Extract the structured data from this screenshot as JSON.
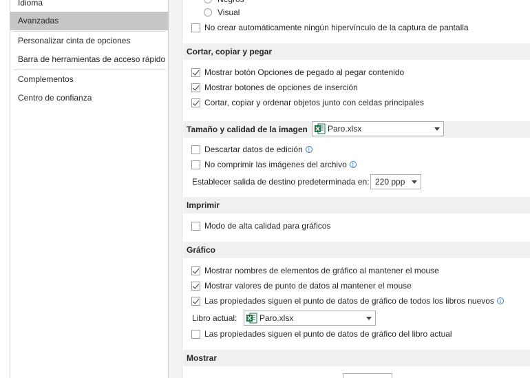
{
  "sidebar": {
    "items": [
      {
        "label": "Idioma"
      },
      {
        "label": "Avanzadas"
      },
      {
        "label": "Personalizar cinta de opciones"
      },
      {
        "label": "Barra de herramientas de acceso rápido"
      },
      {
        "label": "Complementos"
      },
      {
        "label": "Centro de confianza"
      }
    ]
  },
  "top": {
    "radio_partial_label": "Negros",
    "radio_visual_label": "Visual",
    "no_hyperlink_label": "No crear automáticamente ningún hipervínculo de la captura de pantalla"
  },
  "cut_copy_paste": {
    "header": "Cortar, copiar y pegar",
    "show_paste_options": "Mostrar botón Opciones de pegado al pegar contenido",
    "show_insert_options": "Mostrar botones de opciones de inserción",
    "cut_copy_sort": "Cortar, copiar y ordenar objetos junto con celdas principales"
  },
  "image_size": {
    "header": "Tamaño y calidad de la imagen",
    "file_dropdown": "Paro.xlsx",
    "discard_edit_data": "Descartar datos de edición",
    "no_compress": "No comprimir las imágenes del archivo",
    "default_output_label": "Establecer salida de destino predeterminada en:",
    "ppi_value": "220 ppp"
  },
  "print": {
    "header": "Imprimir",
    "high_quality": "Modo de alta calidad para gráficos"
  },
  "chart": {
    "header": "Gráfico",
    "show_element_names": "Mostrar nombres de elementos de gráfico al mantener el mouse",
    "show_data_values": "Mostrar valores de punto de datos al mantener el mouse",
    "props_all_workbooks": "Las propiedades siguen el punto de datos de gráfico de todos los libros nuevos",
    "current_book_label": "Libro actual:",
    "current_book_value": "Paro.xlsx",
    "props_current_workbook": "Las propiedades siguen el punto de datos de gráfico del libro actual"
  },
  "display": {
    "header": "Mostrar"
  },
  "colors": {
    "active_item_bg": "#c6c6c6",
    "section_header_bg": "#f0f0f0",
    "info_blue": "#3a78c3",
    "excel_green": "#1e7145"
  }
}
